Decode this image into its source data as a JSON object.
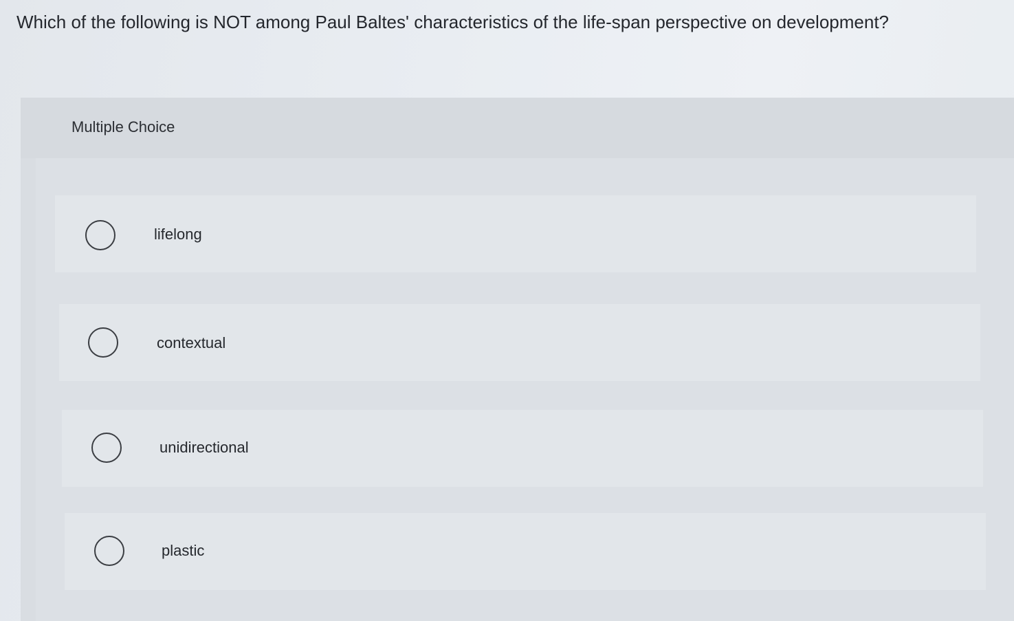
{
  "question": {
    "text": "Which of the following is NOT among Paul Baltes' characteristics of the life-span perspective on development?"
  },
  "panel": {
    "type_label": "Multiple Choice"
  },
  "options": [
    {
      "label": "lifelong",
      "selected": false
    },
    {
      "label": "contextual",
      "selected": false
    },
    {
      "label": "unidirectional",
      "selected": false
    },
    {
      "label": "plastic",
      "selected": false
    }
  ]
}
